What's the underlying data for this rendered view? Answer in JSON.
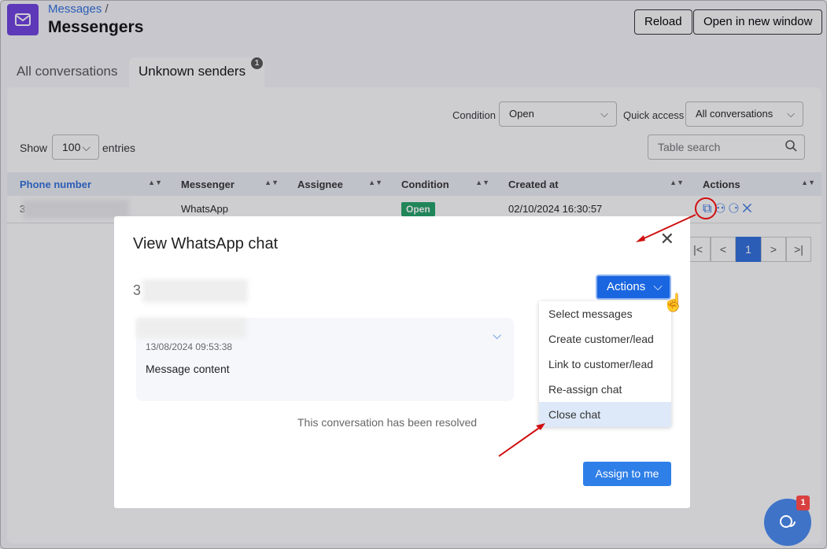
{
  "header": {
    "breadcrumb": "Messages",
    "separator": "/",
    "title": "Messengers",
    "reload": "Reload",
    "open_new": "Open in new window"
  },
  "tabs": [
    {
      "label": "All conversations"
    },
    {
      "label": "Unknown senders",
      "badge": "1"
    }
  ],
  "filters": {
    "condition_label": "Condition",
    "condition_value": "Open",
    "quick_label": "Quick access",
    "quick_value": "All conversations",
    "show": "Show",
    "entries_value": "100",
    "entries": "entries",
    "search_placeholder": "Table search"
  },
  "table": {
    "columns": [
      "Phone number",
      "Messenger",
      "Assignee",
      "Condition",
      "Created at",
      "Actions"
    ],
    "rows": [
      {
        "phone": "3",
        "messenger": "WhatsApp",
        "assignee": "",
        "condition": "Open",
        "created": "02/10/2024 16:30:57"
      }
    ]
  },
  "pagination": {
    "current": "1"
  },
  "modal": {
    "title": "View WhatsApp chat",
    "contact": "3",
    "actions": "Actions",
    "menu": [
      "Select messages",
      "Create customer/lead",
      "Link to customer/lead",
      "Re-assign chat",
      "Close chat"
    ],
    "message": {
      "time": "13/08/2024 09:53:38",
      "content": "Message content"
    },
    "resolved": "This conversation has been resolved",
    "assign": "Assign to me"
  },
  "chat_widget": {
    "badge": "1"
  },
  "colors": {
    "accent": "#1a66e0",
    "brand": "#6f3fe0",
    "open": "#21a366",
    "annotation": "#d01010"
  }
}
